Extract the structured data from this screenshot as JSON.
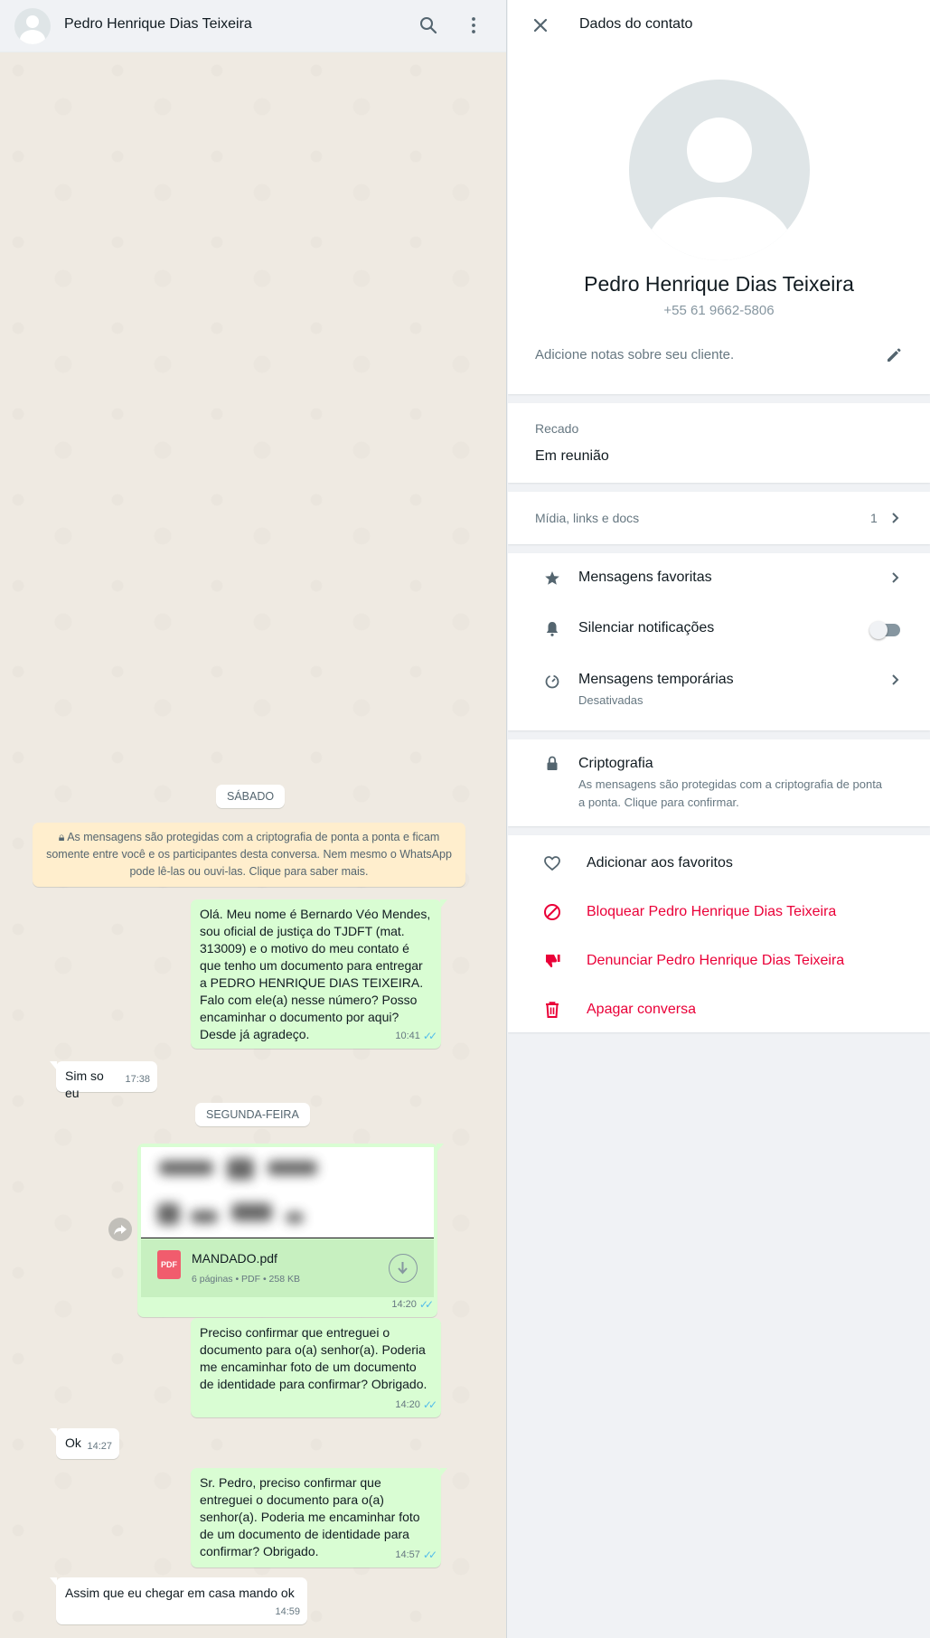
{
  "chat": {
    "contact_name": "Pedro Henrique Dias Teixeira",
    "days": {
      "saturday": "SÁBADO",
      "monday": "SEGUNDA-FEIRA"
    },
    "encryption_notice": "As mensagens são protegidas com a criptografia de ponta a ponta e ficam somente entre você e os participantes desta conversa. Nem mesmo o WhatsApp pode lê-las ou ouvi-las. Clique para saber mais.",
    "messages": [
      {
        "dir": "out",
        "text": "Olá. Meu nome é Bernardo Véo Mendes, sou oficial de justiça do TJDFT (mat. 313009) e o motivo do meu contato é que tenho um documento para entregar a PEDRO HENRIQUE DIAS TEIXEIRA. Falo com ele(a) nesse número? Posso encaminhar o documento por aqui? Desde já agradeço.",
        "time": "10:41"
      },
      {
        "dir": "in",
        "text": "Sim so eu",
        "time": "17:38"
      },
      {
        "dir": "out",
        "type": "document",
        "file_name": "MANDADO.pdf",
        "file_type_badge": "PDF",
        "file_info": "6 páginas • PDF • 258 KB",
        "time": "14:20"
      },
      {
        "dir": "out",
        "text": "Preciso confirmar que entreguei o documento para o(a) senhor(a). Poderia me encaminhar foto de um documento de identidade para confirmar? Obrigado.",
        "time": "14:20"
      },
      {
        "dir": "in",
        "text": "Ok",
        "time": "14:27"
      },
      {
        "dir": "out",
        "text": "Sr. Pedro, preciso confirmar que entreguei o documento para o(a) senhor(a). Poderia me encaminhar foto de um documento de identidade para confirmar? Obrigado.",
        "time": "14:57"
      },
      {
        "dir": "in",
        "text": "Assim que eu chegar em casa mando ok",
        "time": "14:59"
      }
    ]
  },
  "info": {
    "title": "Dados do contato",
    "name": "Pedro Henrique Dias Teixeira",
    "phone": "+55 61 9662-5806",
    "notes_placeholder": "Adicione notas sobre seu cliente.",
    "about_label": "Recado",
    "about_value": "Em reunião",
    "media_label": "Mídia, links e docs",
    "media_count": "1",
    "starred": "Mensagens favoritas",
    "mute": "Silenciar notificações",
    "mute_enabled": false,
    "disappearing": "Mensagens temporárias",
    "disappearing_status": "Desativadas",
    "encryption_title": "Criptografia",
    "encryption_desc": "As mensagens são protegidas com a criptografia de ponta a ponta. Clique para confirmar.",
    "add_favorites": "Adicionar aos favoritos",
    "block": "Bloquear Pedro Henrique Dias Teixeira",
    "report": "Denunciar Pedro Henrique Dias Teixeira",
    "delete": "Apagar conversa"
  },
  "colors": {
    "outgoing_bubble": "#d9fdd3",
    "incoming_bubble": "#ffffff",
    "danger": "#ea0038",
    "read_ticks": "#53bdeb"
  }
}
